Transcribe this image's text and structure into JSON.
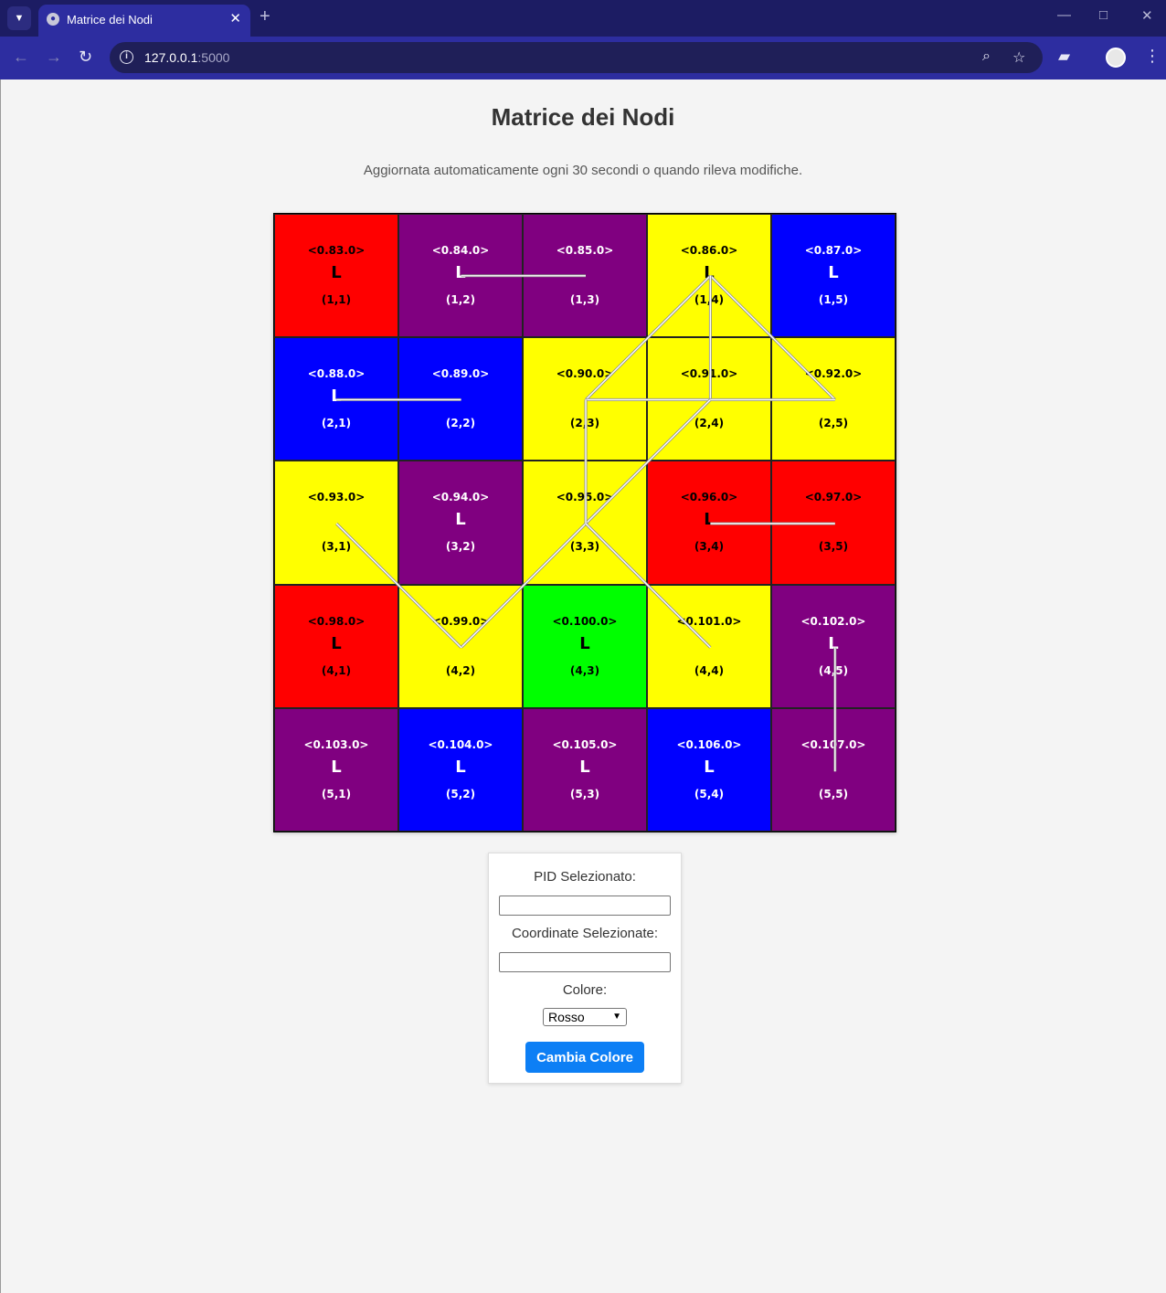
{
  "browser": {
    "tab_title": "Matrice dei Nodi",
    "url_host": "127.0.0.1",
    "url_port": ":5000"
  },
  "page": {
    "title": "Matrice dei Nodi",
    "subtitle": "Aggiornata automaticamente ogni 30 secondi o quando rileva modifiche."
  },
  "colors": {
    "red": "#ff0000",
    "purple": "#800080",
    "yellow": "#ffff00",
    "blue": "#0000ff",
    "green": "#00ff00",
    "button": "#0d7ff5"
  },
  "grid": {
    "rows": [
      [
        {
          "pid": "<0.83.0>",
          "label": "L",
          "coord": "(1,1)",
          "color": "red"
        },
        {
          "pid": "<0.84.0>",
          "label": "L",
          "coord": "(1,2)",
          "color": "purple"
        },
        {
          "pid": "<0.85.0>",
          "label": "",
          "coord": "(1,3)",
          "color": "purple"
        },
        {
          "pid": "<0.86.0>",
          "label": "L",
          "coord": "(1,4)",
          "color": "yellow"
        },
        {
          "pid": "<0.87.0>",
          "label": "L",
          "coord": "(1,5)",
          "color": "blue"
        }
      ],
      [
        {
          "pid": "<0.88.0>",
          "label": "L",
          "coord": "(2,1)",
          "color": "blue"
        },
        {
          "pid": "<0.89.0>",
          "label": "",
          "coord": "(2,2)",
          "color": "blue"
        },
        {
          "pid": "<0.90.0>",
          "label": "",
          "coord": "(2,3)",
          "color": "yellow"
        },
        {
          "pid": "<0.91.0>",
          "label": "",
          "coord": "(2,4)",
          "color": "yellow"
        },
        {
          "pid": "<0.92.0>",
          "label": "",
          "coord": "(2,5)",
          "color": "yellow"
        }
      ],
      [
        {
          "pid": "<0.93.0>",
          "label": "",
          "coord": "(3,1)",
          "color": "yellow"
        },
        {
          "pid": "<0.94.0>",
          "label": "L",
          "coord": "(3,2)",
          "color": "purple"
        },
        {
          "pid": "<0.95.0>",
          "label": "",
          "coord": "(3,3)",
          "color": "yellow"
        },
        {
          "pid": "<0.96.0>",
          "label": "L",
          "coord": "(3,4)",
          "color": "red"
        },
        {
          "pid": "<0.97.0>",
          "label": "",
          "coord": "(3,5)",
          "color": "red"
        }
      ],
      [
        {
          "pid": "<0.98.0>",
          "label": "L",
          "coord": "(4,1)",
          "color": "red"
        },
        {
          "pid": "<0.99.0>",
          "label": "",
          "coord": "(4,2)",
          "color": "yellow"
        },
        {
          "pid": "<0.100.0>",
          "label": "L",
          "coord": "(4,3)",
          "color": "green"
        },
        {
          "pid": "<0.101.0>",
          "label": "",
          "coord": "(4,4)",
          "color": "yellow"
        },
        {
          "pid": "<0.102.0>",
          "label": "L",
          "coord": "(4,5)",
          "color": "purple"
        }
      ],
      [
        {
          "pid": "<0.103.0>",
          "label": "L",
          "coord": "(5,1)",
          "color": "purple"
        },
        {
          "pid": "<0.104.0>",
          "label": "L",
          "coord": "(5,2)",
          "color": "blue"
        },
        {
          "pid": "<0.105.0>",
          "label": "L",
          "coord": "(5,3)",
          "color": "purple"
        },
        {
          "pid": "<0.106.0>",
          "label": "L",
          "coord": "(5,4)",
          "color": "blue"
        },
        {
          "pid": "<0.107.0>",
          "label": "",
          "coord": "(5,5)",
          "color": "purple"
        }
      ]
    ],
    "links": [
      [
        "(1,2)",
        "(1,3)"
      ],
      [
        "(2,1)",
        "(2,2)"
      ],
      [
        "(3,4)",
        "(3,5)"
      ],
      [
        "(4,5)",
        "(5,5)"
      ],
      [
        "(1,4)",
        "(2,3)"
      ],
      [
        "(1,4)",
        "(2,5)"
      ],
      [
        "(1,4)",
        "(2,4)"
      ],
      [
        "(2,3)",
        "(2,5)"
      ],
      [
        "(2,4)",
        "(3,3)"
      ],
      [
        "(2,3)",
        "(3,3)"
      ],
      [
        "(3,3)",
        "(4,2)"
      ],
      [
        "(3,3)",
        "(4,4)"
      ],
      [
        "(3,1)",
        "(4,2)"
      ]
    ]
  },
  "panel": {
    "pid_label": "PID Selezionato:",
    "pid_value": "",
    "coord_label": "Coordinate Selezionate:",
    "coord_value": "",
    "color_label": "Colore:",
    "color_selected": "Rosso",
    "button_label": "Cambia Colore"
  }
}
